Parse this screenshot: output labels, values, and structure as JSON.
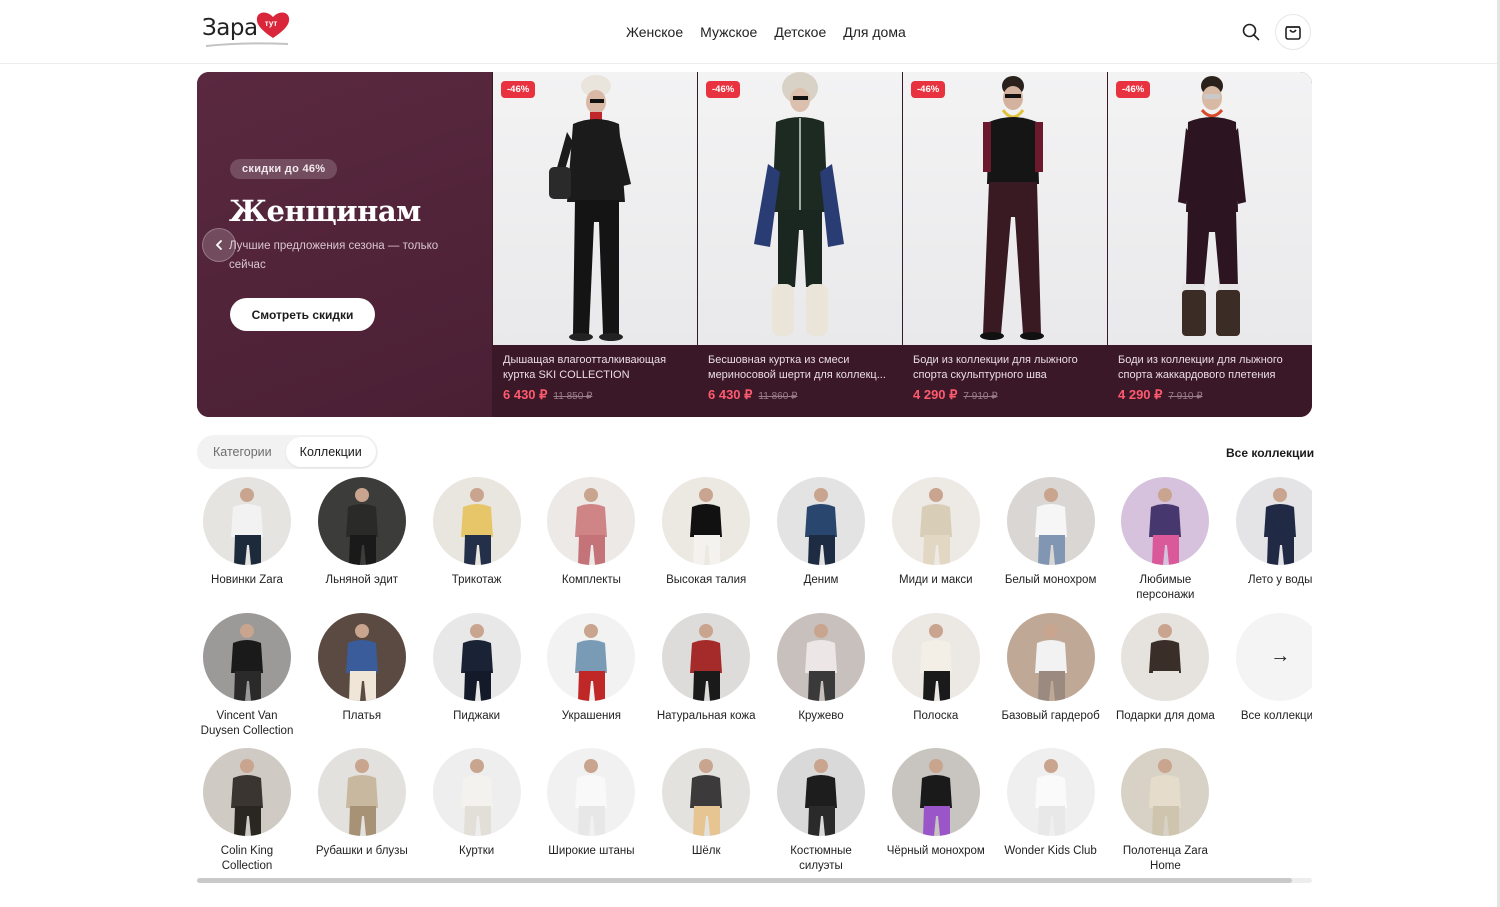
{
  "header": {
    "logo_text": "Зара",
    "logo_badge": "тут",
    "nav": [
      "Женское",
      "Мужское",
      "Детское",
      "Для дома"
    ]
  },
  "hero": {
    "badge": "скидки до 46%",
    "title": "Женщинам",
    "subtitle": "Лучшие предложения сезона — только сейчас",
    "button": "Смотреть скидки",
    "products": [
      {
        "discount": "-46%",
        "name": "Дышащая влагоотталкивающая куртка SKI COLLECTION",
        "price": "6 430 ₽",
        "old_price": "11 850 ₽"
      },
      {
        "discount": "-46%",
        "name": "Бесшовная куртка из смеси мериносовой шерти для коллекц...",
        "price": "6 430 ₽",
        "old_price": "11 860 ₽"
      },
      {
        "discount": "-46%",
        "name": "Боди из коллекции для лыжного спорта скульптурного шва",
        "price": "4 290 ₽",
        "old_price": "7 910 ₽"
      },
      {
        "discount": "-46%",
        "name": "Боди из коллекции для лыжного спорта жаккардового плетения",
        "price": "4 290 ₽",
        "old_price": "7 910 ₽"
      }
    ]
  },
  "tabs": {
    "items": [
      "Категории",
      "Коллекции"
    ],
    "active": "Коллекции",
    "all_link": "Все коллекции"
  },
  "collections": [
    {
      "label": "Новинки Zara",
      "icon": "person-casual"
    },
    {
      "label": "Льняной эдит",
      "icon": "person-dark"
    },
    {
      "label": "Трикотаж",
      "icon": "person-yellow"
    },
    {
      "label": "Комплекты",
      "icon": "pink-set"
    },
    {
      "label": "Высокая талия",
      "icon": "black-white-set"
    },
    {
      "label": "Деним",
      "icon": "person-denim"
    },
    {
      "label": "Миди и макси",
      "icon": "person-beige"
    },
    {
      "label": "Белый монохром",
      "icon": "person-white"
    },
    {
      "label": "Любимые персонажи",
      "icon": "colorful-group"
    },
    {
      "label": "Лето у воды",
      "icon": "navy-dress"
    },
    {
      "label": "Vincent Van Duysen Collection",
      "icon": "black-object"
    },
    {
      "label": "Платья",
      "icon": "child-print"
    },
    {
      "label": "Пиджаки",
      "icon": "navy-jacket"
    },
    {
      "label": "Украшения",
      "icon": "necklace"
    },
    {
      "label": "Натуральная кожа",
      "icon": "red-jacket"
    },
    {
      "label": "Кружево",
      "icon": "lace-top"
    },
    {
      "label": "Полоска",
      "icon": "person-stripe"
    },
    {
      "label": "Базовый гардероб",
      "icon": "person-basic"
    },
    {
      "label": "Подарки для дома",
      "icon": "candles"
    },
    {
      "label": "Все коллекции",
      "icon": "arrow-right"
    },
    {
      "label": "Colin King Collection",
      "icon": "vase"
    },
    {
      "label": "Рубашки и блузы",
      "icon": "person-shirt"
    },
    {
      "label": "Куртки",
      "icon": "puffer-jacket"
    },
    {
      "label": "Широкие штаны",
      "icon": "white-trousers"
    },
    {
      "label": "Шёлк",
      "icon": "person-blond"
    },
    {
      "label": "Костюмные силуэты",
      "icon": "person-suit"
    },
    {
      "label": "Чёрный монохром",
      "icon": "person-purple"
    },
    {
      "label": "Wonder Kids Club",
      "icon": "white-skirt"
    },
    {
      "label": "Полотенца Zara Home",
      "icon": "towel"
    }
  ],
  "colors": {
    "hero_bg": "#4f2237",
    "discount": "#e8323f",
    "price": "#ff5a6e"
  }
}
